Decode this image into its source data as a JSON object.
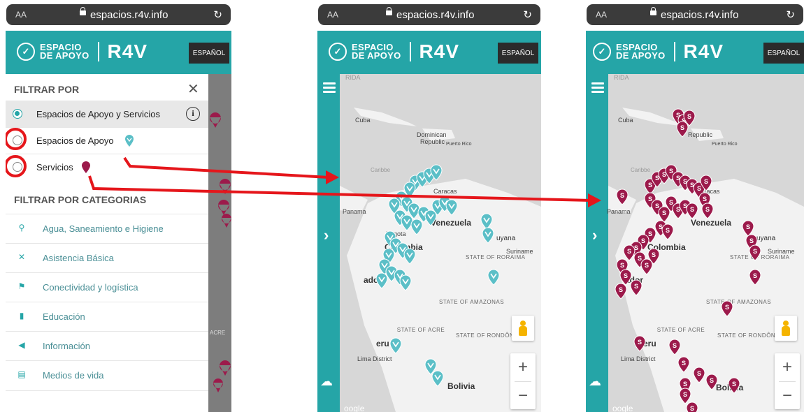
{
  "browser": {
    "text_size": "AA",
    "url": "espacios.r4v.info"
  },
  "header": {
    "logo_line1": "ESPACIO",
    "logo_line2": "DE APOYO",
    "brand": "R4V",
    "language": "ESPAÑOL"
  },
  "filter": {
    "title": "FILTRAR POR",
    "options": [
      {
        "label": "Espacios de Apoyo y Servicios",
        "selected": true
      },
      {
        "label": "Espacios de Apoyo",
        "selected": false
      },
      {
        "label": "Servicios",
        "selected": false
      }
    ]
  },
  "categories": {
    "title": "FILTRAR POR CATEGORIAS",
    "items": [
      {
        "label": "Agua, Saneamiento e Higiene",
        "icon": "water-tap-icon"
      },
      {
        "label": "Asistencia Básica",
        "icon": "basic-assistance-icon"
      },
      {
        "label": "Conectividad y logística",
        "icon": "connectivity-icon"
      },
      {
        "label": "Educación",
        "icon": "book-icon"
      },
      {
        "label": "Información",
        "icon": "megaphone-icon"
      },
      {
        "label": "Medios de vida",
        "icon": "livelihood-icon"
      }
    ]
  },
  "map_labels": {
    "florida": "RIDA",
    "cuba": "Cuba",
    "dominican": "Dominican",
    "republic": "Republic",
    "puerto_rico": "Puerto Rico",
    "caribbean": "Caribbe",
    "caracas": "Caracas",
    "panama": "Panama",
    "bogota": "Bogota",
    "venezuela": "Venezuela",
    "colombia": "Colombia",
    "guyana": "uyana",
    "suriname": "Suriname",
    "roraima": "STATE OF RORAIMA",
    "amazonas": "STATE OF AMAZONAS",
    "acre": "STATE OF ACRE",
    "rondonia": "STATE OF RONDÔNIA",
    "peru": "eru",
    "lima": "Lima District",
    "bolivia": "Bolivia",
    "ecuador": "ador",
    "google": "oogle",
    "acre_cut": "ACRE"
  },
  "map_controls": {
    "zoom_in": "+",
    "zoom_out": "−"
  },
  "colors": {
    "teal": "#25a5a7",
    "marker_space": "#5bbfc7",
    "marker_service": "#9c1a4b",
    "annotation_red": "#e5161b"
  }
}
